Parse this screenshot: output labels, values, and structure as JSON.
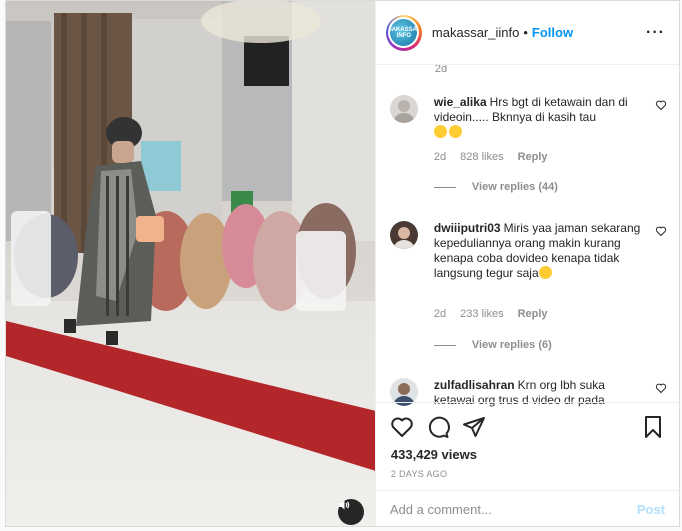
{
  "post": {
    "username": "makassar_iinfo",
    "separator": "•",
    "follow_label": "Follow",
    "more_icon": "more-options-icon",
    "avatar_text": "MAKASSAR INFO"
  },
  "caption_time": "2d",
  "comments": [
    {
      "username": "wie_alika",
      "text": "Hrs bgt di ketawain dan di videoin..... Bknnya di kasih tau ",
      "emojis": [
        "crying-face-emoji",
        "crying-face-emoji"
      ],
      "time": "2d",
      "likes": "828 likes",
      "reply_label": "Reply",
      "view_replies": "View replies (44)"
    },
    {
      "username": "dwiiiputri03",
      "text": "Miris yaa jaman sekarang kepeduliannya orang makin kurang kenapa coba dovideo kenapa tidak langsung tegur saja",
      "emojis": [
        "smiling-face-emoji"
      ],
      "time": "2d",
      "likes": "233 likes",
      "reply_label": "Reply",
      "view_replies": "View replies (6)"
    },
    {
      "username": "zulfadlisahran",
      "text": "Krn org lbh suka ketawai org trus d video dr pada"
    }
  ],
  "actions": {
    "views": "433,429 views",
    "time_ago": "2 DAYS AGO"
  },
  "add_comment": {
    "placeholder": "Add a comment...",
    "post_label": "Post",
    "post_color": "#b2dffc"
  },
  "colors": {
    "accent": "#0095f6",
    "muted": "#8e8e8e",
    "text": "#262626",
    "carpet": "#b3262a"
  }
}
